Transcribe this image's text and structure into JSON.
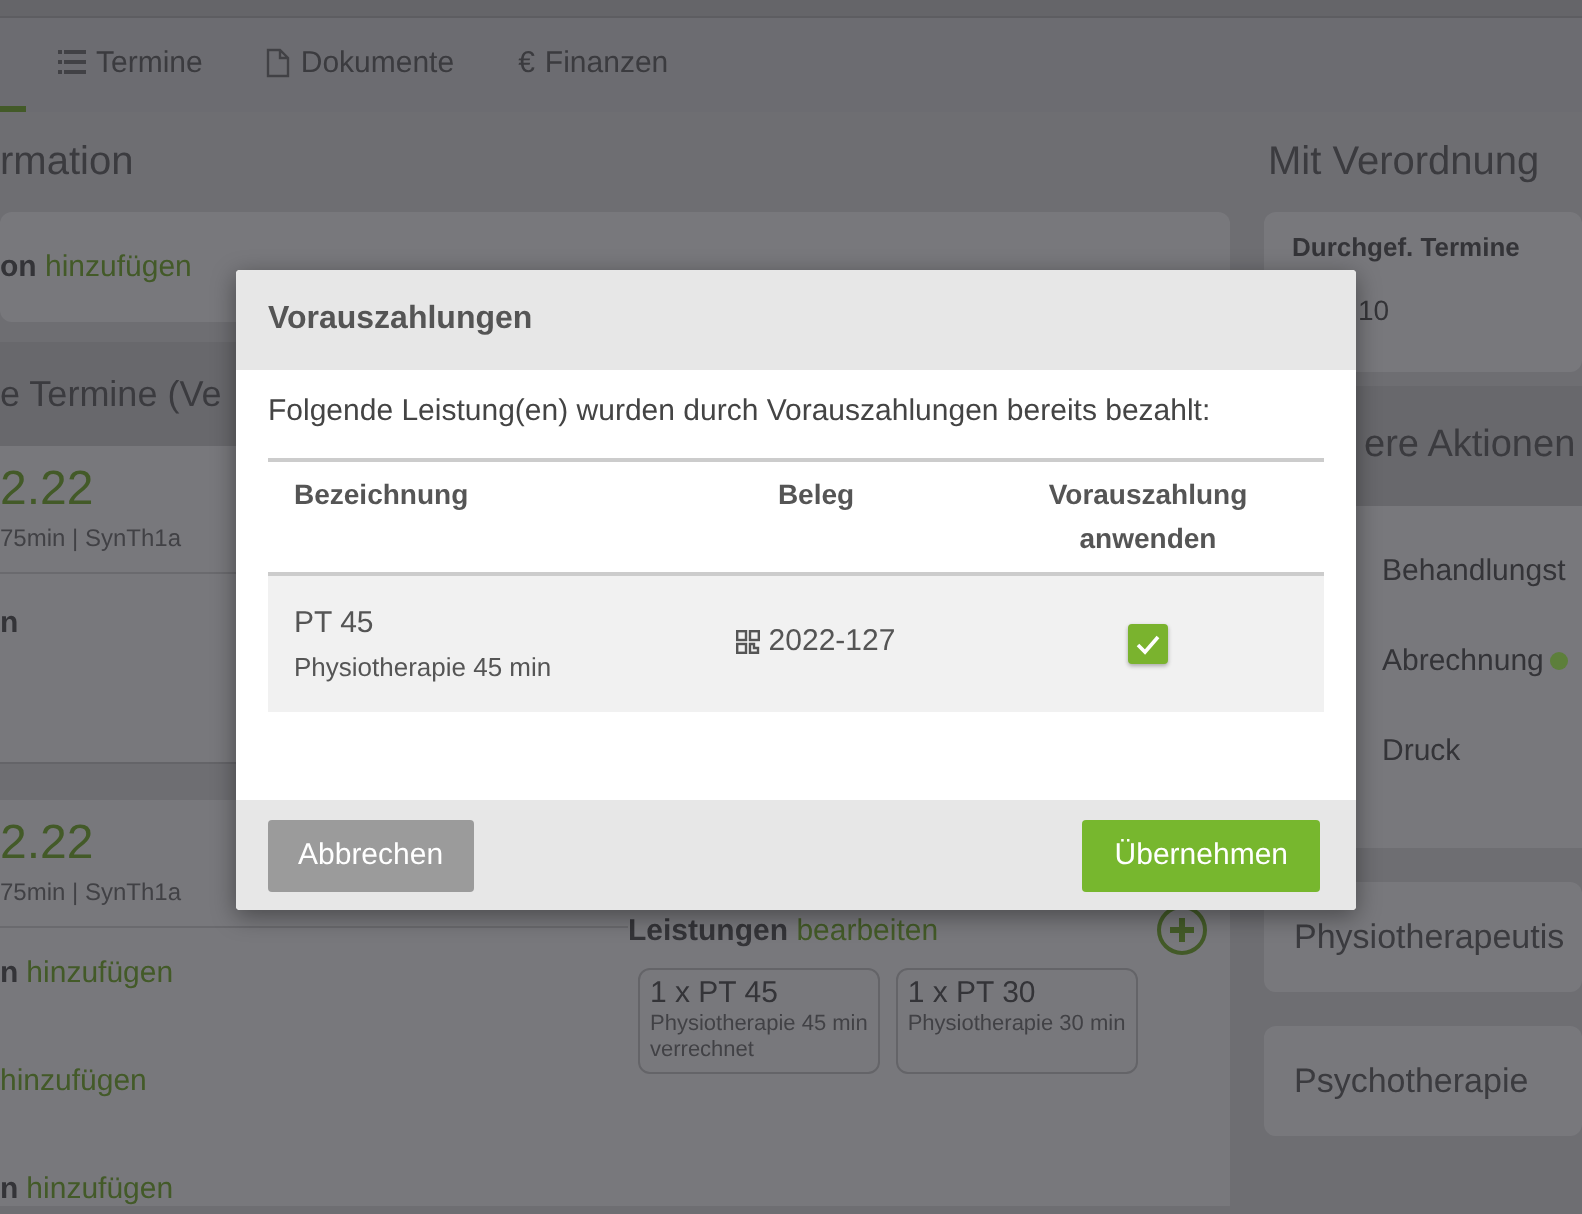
{
  "partial_tab": {
    "selected": true
  },
  "tabs": [
    {
      "label": "Termine",
      "selected": false
    },
    {
      "label": "Dokumente",
      "selected": false
    },
    {
      "symbol": "€",
      "label": "Finanzen",
      "selected": false
    }
  ],
  "info_section": {
    "heading": "rmation",
    "prefix": "on",
    "link": "hinzufügen"
  },
  "appointments_section": {
    "heading": "e Termine (Ve",
    "cards": [
      {
        "date": "2.22",
        "meta": "75min | SynTh1a",
        "lines": [
          {
            "prefix": "n"
          }
        ]
      },
      {
        "date": "2.22",
        "meta": "75min | SynTh1a",
        "lines": [
          {
            "prefix": "n",
            "link": "hinzufügen"
          },
          {
            "link": "hinzufügen"
          },
          {
            "prefix": "n",
            "link": "hinzufügen"
          }
        ],
        "services": {
          "label": "Leistungen",
          "link": "bearbeiten",
          "items": [
            {
              "title": "1 x PT 45",
              "description": "Physiotherapie 45 min",
              "status": "verrechnet"
            },
            {
              "title": "1 x PT 30",
              "description": "Physiotherapie 30 min"
            }
          ]
        }
      }
    ]
  },
  "prescription": {
    "heading": "Mit Verordnung",
    "label": "Durchgef. Termine",
    "value": "10"
  },
  "actions": {
    "heading": "ere Aktionen",
    "items": [
      {
        "label": "Behandlungst"
      },
      {
        "label": "Abrechnung",
        "color": "#5d7f3b"
      },
      {
        "label": "Druck"
      }
    ]
  },
  "categories": [
    {
      "label": "Physiotherapeutis"
    },
    {
      "label": "Psychotherapie"
    }
  ],
  "modal": {
    "title": "Vorauszahlungen",
    "message": "Folgende Leistung(en) wurden durch Vorauszahlungen bereits bezahlt:",
    "columns": [
      "Bezeichnung",
      "Beleg",
      "Vorauszahlung anwenden"
    ],
    "rows": [
      {
        "code": "PT 45",
        "description": "Physiotherapie 45 min",
        "receipt": "2022-127",
        "apply": true
      }
    ],
    "buttons": [
      {
        "label": "Abbrechen",
        "kind": "secondary"
      },
      {
        "label": "Übernehmen",
        "kind": "primary"
      }
    ]
  }
}
